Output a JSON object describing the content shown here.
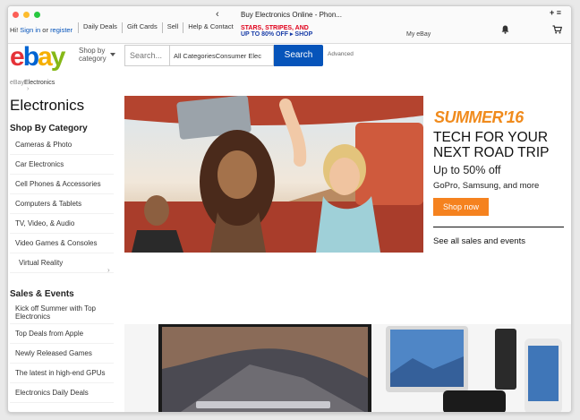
{
  "browser": {
    "tab_title": "Buy Electronics Online - Phon...",
    "back_label": "‹",
    "plus_label": "+ ≡"
  },
  "topbar": {
    "greeting": "Hi!",
    "sign_in": "Sign in",
    "or": "or",
    "register": "register",
    "nav": [
      "Daily Deals",
      "Gift Cards",
      "Sell",
      "Help & Contact"
    ],
    "promo_line1": "STARS, STRIPES, AND",
    "promo_line2": "UP TO 80% OFF ▸ SHOP",
    "my_ebay": "My eBay"
  },
  "header": {
    "logo": {
      "e": "e",
      "b": "b",
      "a": "a",
      "y": "y"
    },
    "shop_by_line1": "Shop by",
    "shop_by_line2": "category",
    "search_placeholder": "Search...",
    "category_value": "All CategoriesConsumer Elec",
    "search_button": "Search",
    "advanced": "Advanced"
  },
  "breadcrumb": {
    "home": "eBay",
    "current": "Electronics",
    "chevron": "›"
  },
  "page_title": "Electronics",
  "shop_by_category": {
    "heading": "Shop By Category",
    "items": [
      "Cameras & Photo",
      "Car Electronics",
      "Cell Phones & Accessories",
      "Computers & Tablets",
      "TV, Video, & Audio",
      "Video Games & Consoles",
      "Virtual Reality"
    ],
    "more_chevron": "›"
  },
  "sales_events": {
    "heading": "Sales & Events",
    "items": [
      "Kick off Summer with Top Electronics",
      "Top Deals from Apple",
      "Newly Released Games",
      "The latest in high-end GPUs",
      "Electronics Daily Deals"
    ]
  },
  "hero": {
    "summer": "SUMMER'16",
    "headline_line1": "TECH FOR YOUR",
    "headline_line2": "NEXT ROAD TRIP",
    "discount": "Up to 50% off",
    "brands": "GoPro, Samsung, and more",
    "cta": "Shop now",
    "see_all": "See all sales and events"
  },
  "colors": {
    "ebay_red": "#e53238",
    "ebay_blue": "#0064d2",
    "ebay_yellow": "#f5af02",
    "ebay_green": "#86b817",
    "search_button": "#0654ba",
    "summer_orange": "#f08b1d",
    "shop_now": "#f5821f"
  }
}
